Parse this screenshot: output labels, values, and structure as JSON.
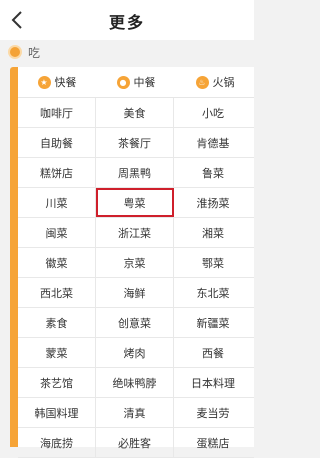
{
  "header": {
    "title": "更多"
  },
  "section": {
    "label": "吃"
  },
  "tabs": [
    {
      "label": "快餐",
      "icon": "fastfood-icon"
    },
    {
      "label": "中餐",
      "icon": "chinese-food-icon"
    },
    {
      "label": "火锅",
      "icon": "hotpot-icon"
    }
  ],
  "grid": [
    [
      "咖啡厅",
      "美食",
      "小吃"
    ],
    [
      "自助餐",
      "茶餐厅",
      "肯德基"
    ],
    [
      "糕饼店",
      "周黑鸭",
      "鲁菜"
    ],
    [
      "川菜",
      "粤菜",
      "淮扬菜"
    ],
    [
      "闽菜",
      "浙江菜",
      "湘菜"
    ],
    [
      "徽菜",
      "京菜",
      "鄂菜"
    ],
    [
      "西北菜",
      "海鲜",
      "东北菜"
    ],
    [
      "素食",
      "创意菜",
      "新疆菜"
    ],
    [
      "蒙菜",
      "烤肉",
      "西餐"
    ],
    [
      "茶艺馆",
      "绝味鸭脖",
      "日本料理"
    ],
    [
      "韩国料理",
      "清真",
      "麦当劳"
    ],
    [
      "海底捞",
      "必胜客",
      "蛋糕店"
    ]
  ],
  "selected": "粤菜",
  "colors": {
    "accent": "#f6a437",
    "highlight": "#cf1f2b"
  }
}
